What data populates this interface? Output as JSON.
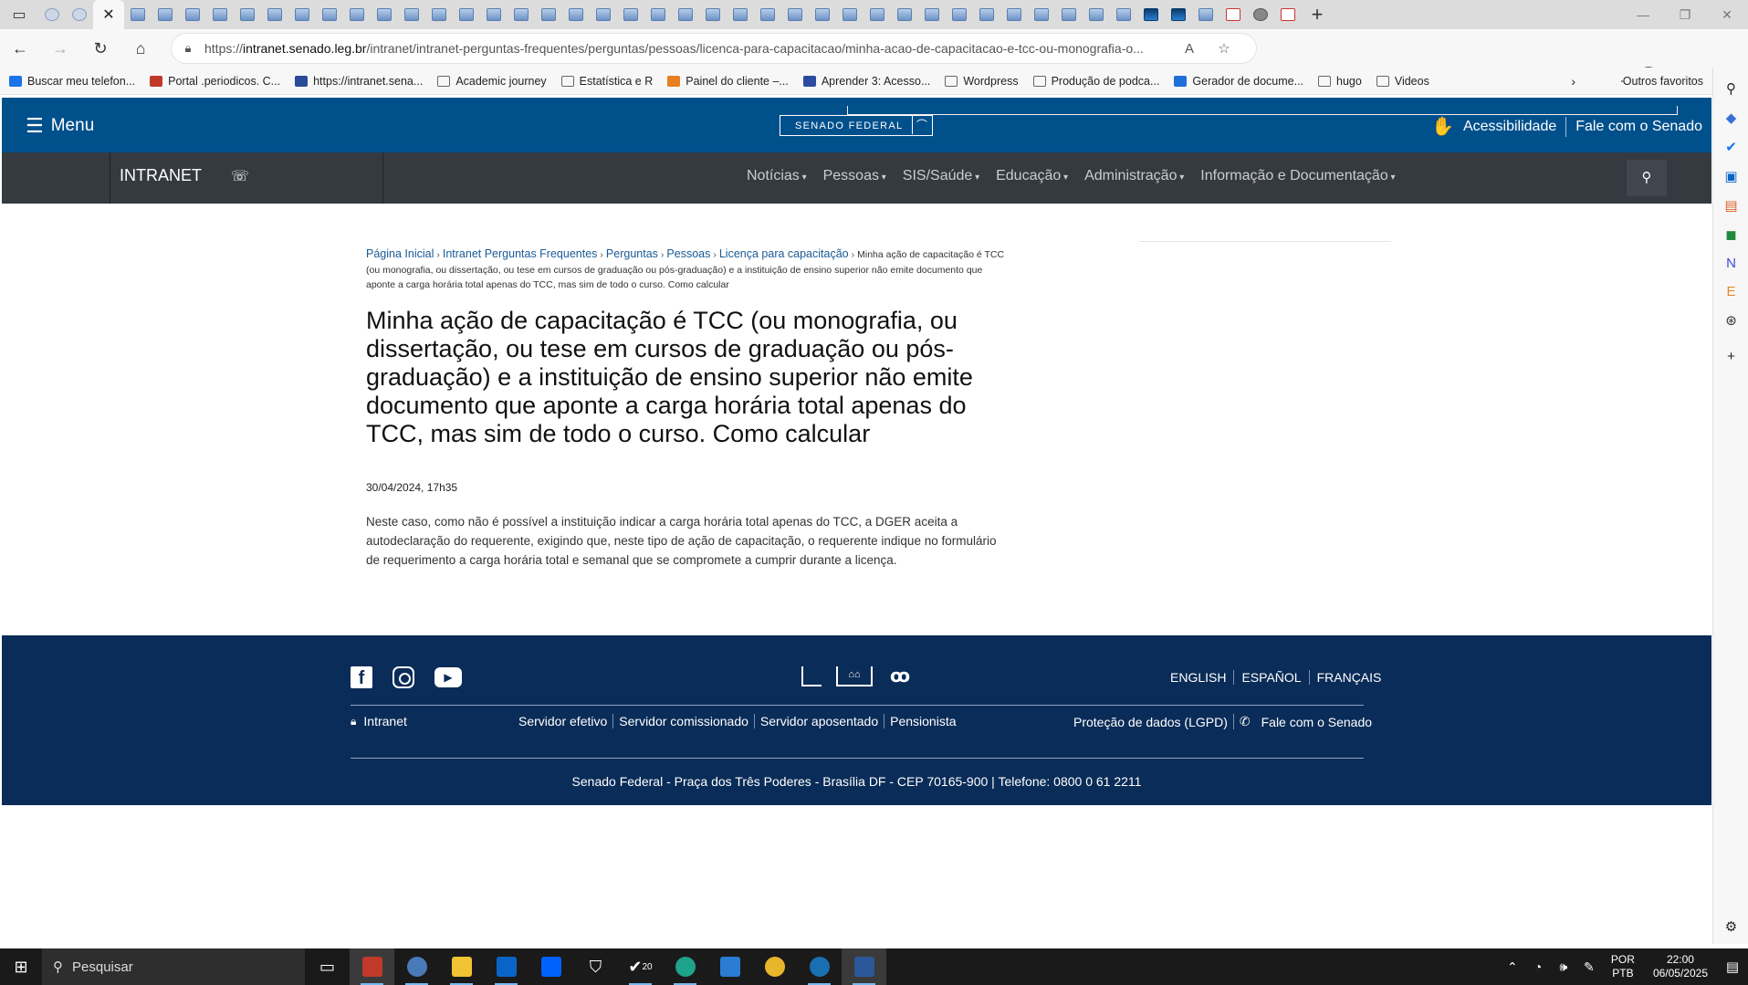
{
  "browser": {
    "url_prefix": "https://",
    "url_host": "intranet.senado.leg.br",
    "url_path": "/intranet/intranet-perguntas-frequentes/perguntas/pessoas/licenca-para-capacitacao/minha-acao-de-capacitacao-e-tcc-ou-monografia-o...",
    "bookmarks": [
      {
        "label": "Buscar meu telefon...",
        "color": "#1a73e8"
      },
      {
        "label": "Portal .periodicos. C...",
        "color": "#c0392b"
      },
      {
        "label": "https://intranet.sena...",
        "color": "#2b4a9a"
      },
      {
        "label": "Academic journey",
        "color": "folder"
      },
      {
        "label": "Estatística e R",
        "color": "folder"
      },
      {
        "label": "Painel do cliente –...",
        "color": "#e67e22"
      },
      {
        "label": "Aprender 3: Acesso...",
        "color": "#2b4aa0"
      },
      {
        "label": "Wordpress",
        "color": "folder"
      },
      {
        "label": "Produção de podca...",
        "color": "folder"
      },
      {
        "label": "Gerador de docume...",
        "color": "#1e6fd9"
      },
      {
        "label": "hugo",
        "color": "folder"
      },
      {
        "label": "Videos",
        "color": "folder"
      }
    ],
    "other_favorites": "Outros favoritos"
  },
  "header": {
    "menu_label": "Menu",
    "logo_text": "SENADO FEDERAL",
    "accessibility": "Acessibilidade",
    "contact": "Fale com o Senado"
  },
  "navbar": {
    "brand": "INTRANET",
    "items": [
      "Notícias",
      "Pessoas",
      "SIS/Saúde",
      "Educação",
      "Administração",
      "Informação e Documentação"
    ]
  },
  "article": {
    "breadcrumbs": [
      "Página Inicial",
      "Intranet Perguntas Frequentes",
      "Perguntas",
      "Pessoas",
      "Licença para capacitação"
    ],
    "breadcrumb_current": "Minha ação de capacitação é TCC (ou monografia, ou dissertação, ou tese em cursos de graduação ou pós-graduação) e a instituição de ensino superior não emite documento que aponte a carga horária total apenas do TCC, mas sim de todo o curso. Como calcular",
    "title": "Minha ação de capacitação é TCC (ou monografia, ou dissertação, ou tese em cursos de graduação ou pós-graduação) e a instituição de ensino superior não emite documento que aponte a carga horária total apenas do TCC, mas sim de todo o curso. Como calcular",
    "date": "30/04/2024, 17h35",
    "body": "Neste caso, como não é possível a instituição indicar a carga horária total apenas do TCC, a DGER aceita a autodeclaração do requerente, exigindo que, neste tipo de ação de capacitação, o requerente indique no formulário de requerimento a carga horária total e semanal que se compromete a cumprir durante a licença."
  },
  "footer": {
    "languages": [
      "ENGLISH",
      "ESPAÑOL",
      "FRANÇAIS"
    ],
    "intranet": "Intranet",
    "links": [
      "Servidor efetivo",
      "Servidor comissionado",
      "Servidor aposentado",
      "Pensionista"
    ],
    "privacy": "Proteção de dados (LGPD)",
    "contact": "Fale com o Senado",
    "address": "Senado Federal - Praça dos Três Poderes - Brasília DF - CEP 70165-900 | Telefone: 0800 0 61 2211"
  },
  "taskbar": {
    "search_placeholder": "Pesquisar",
    "badge": "20",
    "lang_line1": "POR",
    "lang_line2": "PTB",
    "time": "22:00",
    "date": "06/05/2025"
  }
}
